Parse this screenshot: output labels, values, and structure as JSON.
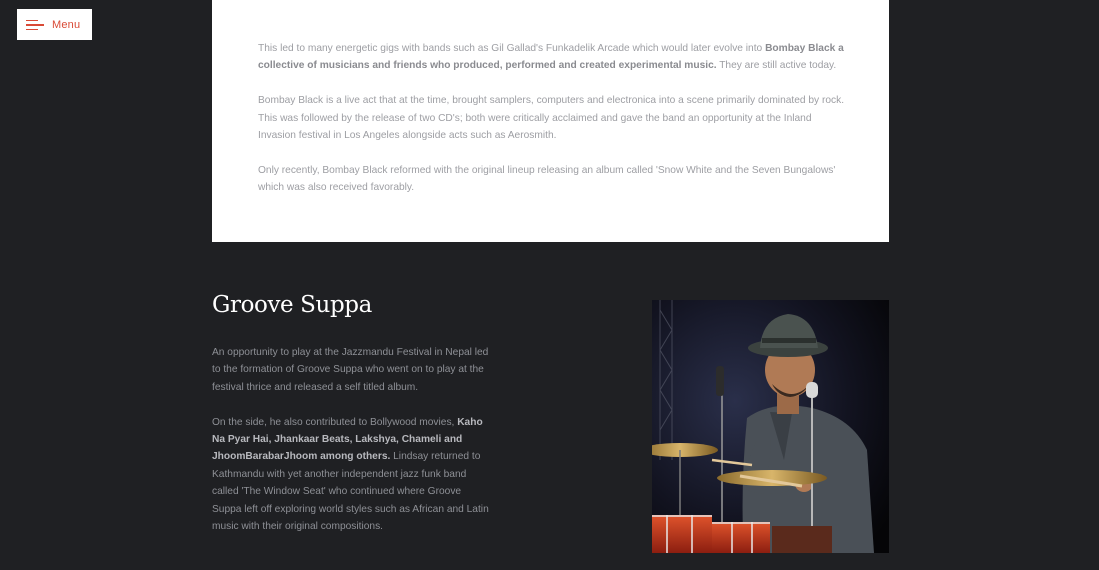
{
  "menu": {
    "label": "Menu",
    "icon": "hamburger-icon",
    "accent_color": "#d94a36"
  },
  "card": {
    "p1_prefix": "This led to many energetic gigs with bands such as Gil Gallad's Funkadelik Arcade which would later evolve into ",
    "p1_bold": "Bombay Black a collective of musicians and friends who produced, performed and created experimental music.",
    "p1_suffix": " They are still active today.",
    "p2": "Bombay Black is a live act that at the time, brought samplers, computers and electronica into a scene primarily dominated by rock. This was followed by the release of two CD's; both were critically acclaimed and gave the band an opportunity at the Inland Invasion festival in Los Angeles alongside acts such as Aerosmith.",
    "p3": "Only recently, Bombay Black reformed with the original lineup releasing an album called 'Snow White and the Seven Bungalows' which was also received favorably."
  },
  "section": {
    "title": "Groove Suppa",
    "p1": "An opportunity to play at the Jazzmandu Festival in Nepal led to the formation of Groove Suppa who went on to play at the festival thrice and released a self titled album.",
    "p2_prefix": "On the side, he also contributed to Bollywood movies, ",
    "p2_bold": "Kaho Na Pyar Hai, Jhankaar Beats, Lakshya, Chameli and JhoomBarabarJhoom among others.",
    "p2_suffix": " Lindsay returned to Kathmandu with yet another independent jazz funk band called 'The Window Seat' who continued where Groove Suppa left off exploring world styles such as African and Latin music with their original compositions."
  },
  "photo": {
    "subject": "drummer-photo"
  },
  "colors": {
    "page_background": "#1f2023",
    "card_background": "#ffffff",
    "body_text": "#9d9ea3",
    "title_text": "#ffffff"
  }
}
